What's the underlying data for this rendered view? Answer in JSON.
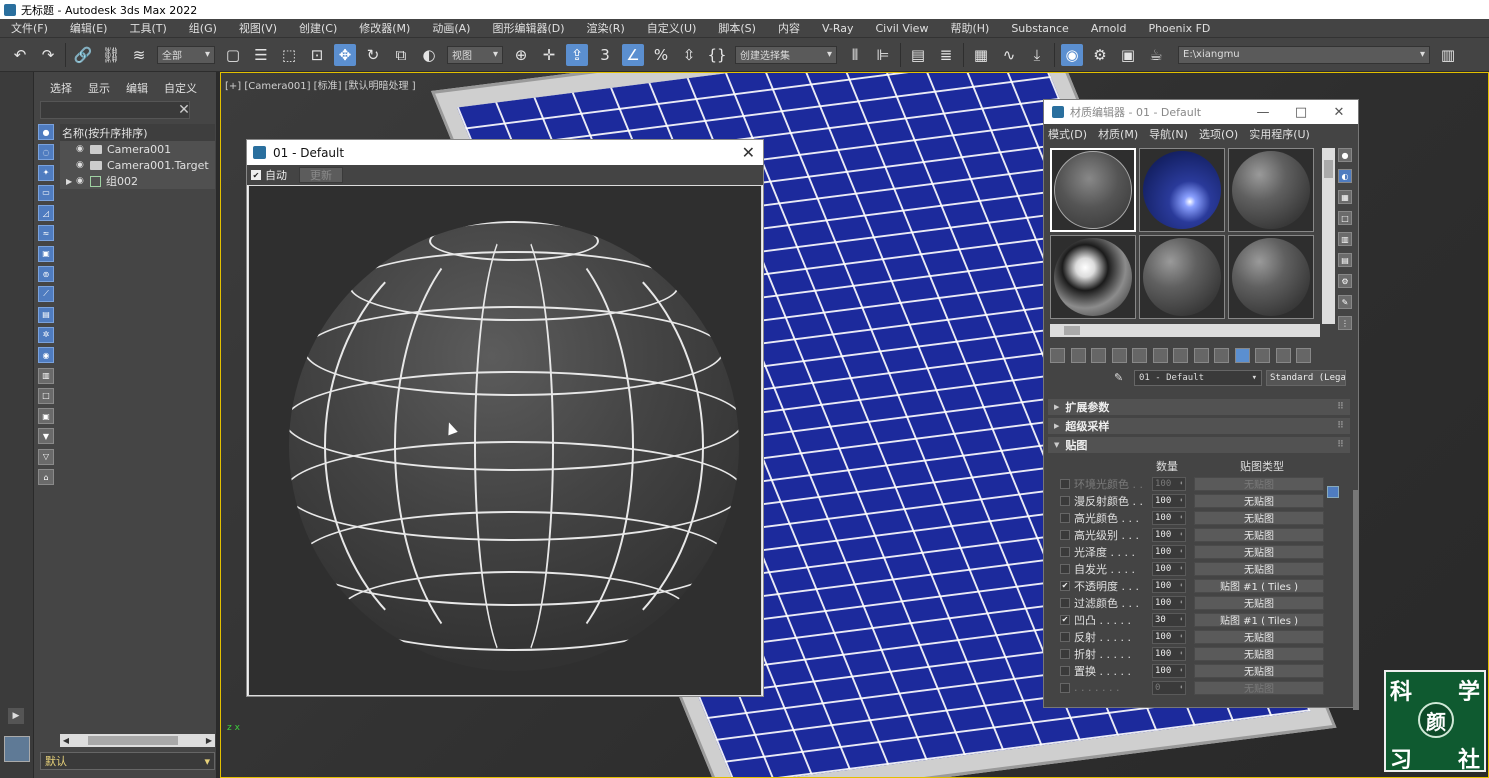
{
  "window": {
    "title": "无标题 - Autodesk 3ds Max 2022"
  },
  "menubar": [
    "文件(F)",
    "编辑(E)",
    "工具(T)",
    "组(G)",
    "视图(V)",
    "创建(C)",
    "修改器(M)",
    "动画(A)",
    "图形编辑器(D)",
    "渲染(R)",
    "自定义(U)",
    "脚本(S)",
    "内容",
    "V-Ray",
    "Civil View",
    "帮助(H)",
    "Substance",
    "Arnold",
    "Phoenix FD"
  ],
  "toolbar": {
    "filter_select": "全部",
    "view_select": "视图",
    "selection_set_select": "创建选择集",
    "path_field": "E:\\xiangmu"
  },
  "explorer": {
    "tabs": [
      "选择",
      "显示",
      "编辑",
      "自定义"
    ],
    "header": "名称(按升序排序)",
    "items": [
      {
        "name": "Camera001"
      },
      {
        "name": "Camera001.Target"
      },
      {
        "name": "组002"
      }
    ],
    "layer": "默认"
  },
  "viewport": {
    "label": "[+] [Camera001] [标准] [默认明暗处理 ]",
    "axis": "z x"
  },
  "preview": {
    "title": "01 - Default",
    "auto_label": "自动",
    "update_button": "更新"
  },
  "material_editor": {
    "title": "材质编辑器 - 01 - Default",
    "window_controls": [
      "—",
      "□",
      "✕"
    ],
    "menu": [
      "模式(D)",
      "材质(M)",
      "导航(N)",
      "选项(O)",
      "实用程序(U)"
    ],
    "material_name": "01 - Default",
    "material_type": "Standard (Legacy)",
    "rollouts": [
      {
        "label": "扩展参数",
        "open": false
      },
      {
        "label": "超级采样",
        "open": false
      },
      {
        "label": "贴图",
        "open": true
      }
    ],
    "maps_header": {
      "amount": "数量",
      "map_type": "贴图类型"
    },
    "maps": [
      {
        "name": "环境光颜色 . .",
        "checked": false,
        "amount": "100",
        "map": "无贴图",
        "dim": true
      },
      {
        "name": "漫反射颜色 . .",
        "checked": false,
        "amount": "100",
        "map": "无贴图",
        "dim": false
      },
      {
        "name": "高光颜色 . . .",
        "checked": false,
        "amount": "100",
        "map": "无贴图",
        "dim": false
      },
      {
        "name": "高光级别 . . .",
        "checked": false,
        "amount": "100",
        "map": "无贴图",
        "dim": false
      },
      {
        "name": "光泽度 . . . .",
        "checked": false,
        "amount": "100",
        "map": "无贴图",
        "dim": false
      },
      {
        "name": "自发光 . . . .",
        "checked": false,
        "amount": "100",
        "map": "无贴图",
        "dim": false
      },
      {
        "name": "不透明度 . . .",
        "checked": true,
        "amount": "100",
        "map": "贴图 #1 ( Tiles )",
        "dim": false
      },
      {
        "name": "过滤颜色 . . .",
        "checked": false,
        "amount": "100",
        "map": "无贴图",
        "dim": false
      },
      {
        "name": "凹凸 . . . . .",
        "checked": true,
        "amount": "30",
        "map": "贴图 #1 ( Tiles )",
        "dim": false
      },
      {
        "name": "反射 . . . . .",
        "checked": false,
        "amount": "100",
        "map": "无贴图",
        "dim": false
      },
      {
        "name": "折射 . . . . .",
        "checked": false,
        "amount": "100",
        "map": "无贴图",
        "dim": false
      },
      {
        "name": "置换 . . . . .",
        "checked": false,
        "amount": "100",
        "map": "无贴图",
        "dim": false
      },
      {
        "name": ". . . . . . .",
        "checked": false,
        "amount": "0",
        "map": "无贴图",
        "dim": true
      }
    ]
  },
  "watermark": {
    "chars": [
      "科",
      "学",
      "颜",
      "习",
      "社"
    ]
  }
}
